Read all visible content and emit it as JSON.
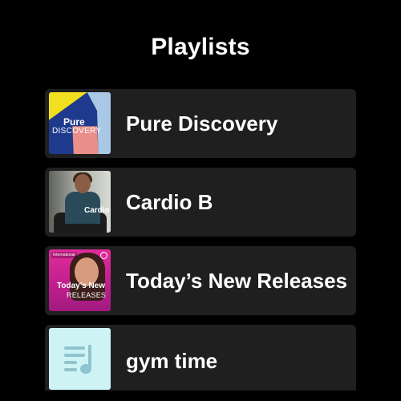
{
  "page": {
    "title": "Playlists"
  },
  "playlists": [
    {
      "name": "Pure Discovery",
      "art": {
        "line1": "Pure",
        "line2": "DISCOVERY"
      }
    },
    {
      "name": "Cardio B",
      "art": {
        "line1": "Cardio"
      }
    },
    {
      "name": "Today’s New Releases",
      "art": {
        "tag": "International",
        "line1": "Today’s New",
        "line2": "RELEASES"
      }
    },
    {
      "name": "gym time",
      "art": {
        "icon": "music-note-list-icon"
      }
    }
  ],
  "colors": {
    "background": "#000000",
    "card": "#1f1f1f",
    "text": "#ffffff",
    "gym_tile": "#cdf3f4",
    "gym_icon": "#8fc3cf"
  }
}
